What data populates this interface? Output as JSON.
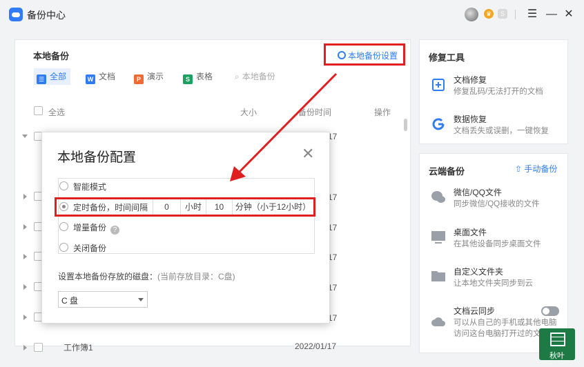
{
  "app": {
    "title": "备份中心"
  },
  "titlebar": {
    "vip_icon": "crown-icon",
    "s_icon": "S",
    "menu": "☰",
    "minimize": "—",
    "close": "✕"
  },
  "local_backup": {
    "title": "本地备份",
    "settings_link": "本地备份设置",
    "filters": [
      {
        "label": "全部",
        "icon": "all-icon",
        "color": "#2f7cf6",
        "active": true
      },
      {
        "label": "文档",
        "icon": "W",
        "color": "#2f7cf6"
      },
      {
        "label": "演示",
        "icon": "P",
        "color": "#f06a35"
      },
      {
        "label": "表格",
        "icon": "S",
        "color": "#1aa260"
      },
      {
        "label": "本地备份",
        "icon": "search-icon",
        "color": "#999"
      }
    ],
    "headers": {
      "select_all": "全选",
      "size": "大小",
      "backup_time": "备份时间",
      "action": "操作"
    },
    "rows": [
      {
        "name": "",
        "date": "17"
      },
      {
        "name": "",
        "date": "17"
      },
      {
        "name": "",
        "date": "17"
      },
      {
        "name": "",
        "date": "17"
      },
      {
        "name": "",
        "date": "17"
      },
      {
        "name": "",
        "date": "17"
      },
      {
        "name": "工作簿1",
        "date": "2022/01/17"
      }
    ]
  },
  "repair_tools": {
    "title": "修复工具",
    "items": [
      {
        "title": "文档修复",
        "desc": "修复乱码/无法打开的文档"
      },
      {
        "title": "数据恢复",
        "desc": "文档丢失或误删，一键恢复"
      }
    ]
  },
  "cloud_backup": {
    "title": "云端备份",
    "manual": "手动备份",
    "items": [
      {
        "title": "微信/QQ文件",
        "desc": "同步微信/QQ接收的文件"
      },
      {
        "title": "桌面文件",
        "desc": "在其他设备同步桌面文件"
      },
      {
        "title": "自定义文件夹",
        "desc": "让本地文件夹同步到云"
      },
      {
        "title": "文档云同步",
        "desc": "可以从自己的手机或其他电脑",
        "desc2": "访问这台电脑打开过的文"
      }
    ]
  },
  "dialog": {
    "title": "本地备份配置",
    "close": "✕",
    "options": {
      "smart": "智能模式",
      "timed": "定时备份，时间间隔",
      "hours_value": "0",
      "hours_unit": "小时",
      "minutes_value": "10",
      "minutes_unit": "分钟（小于12小时）",
      "incremental": "增量备份",
      "help": "?",
      "off": "关闭备份"
    },
    "disk_label": "设置本地备份存放的磁盘：",
    "disk_current": "(当前存放目录：C盘)",
    "disk_value": "C 盘"
  },
  "taskbar_badge": {
    "label": "秋叶"
  },
  "colors": {
    "accent": "#2f7cf6",
    "highlight_red": "#e02020"
  }
}
